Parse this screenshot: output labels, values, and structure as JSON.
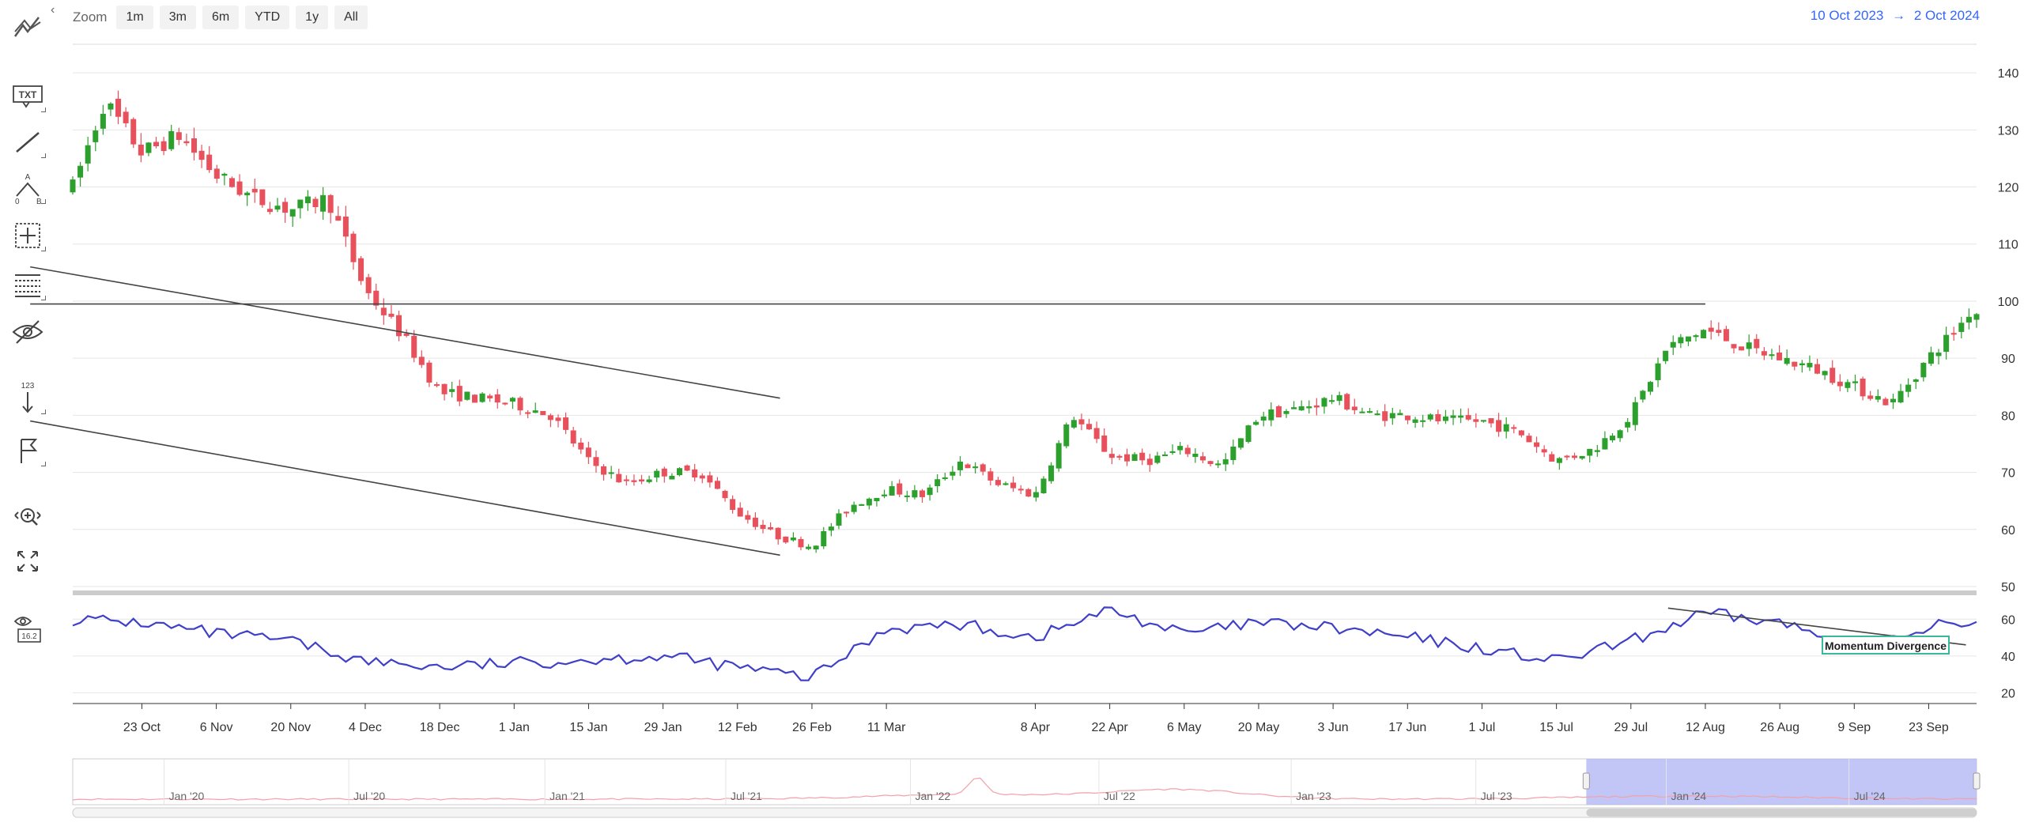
{
  "toolbar": {
    "collapse_glyph": "‹",
    "tools": [
      {
        "name": "indicators-icon",
        "label": ""
      },
      {
        "name": "text-annotation-icon",
        "label": "TXT"
      },
      {
        "name": "line-tool-icon",
        "label": ""
      },
      {
        "name": "elliott-wave-icon",
        "label": "A 0 B"
      },
      {
        "name": "measure-icon",
        "label": ""
      },
      {
        "name": "fibonacci-icon",
        "label": ""
      },
      {
        "name": "hide-annotations-icon",
        "label": ""
      },
      {
        "name": "vertical-counter-icon",
        "label": "123"
      },
      {
        "name": "flag-icon",
        "label": ""
      },
      {
        "name": "zoom-pan-icon",
        "label": ""
      },
      {
        "name": "fullscreen-icon",
        "label": ""
      },
      {
        "name": "current-price-indicator-icon",
        "label": "16.2"
      }
    ]
  },
  "zoom": {
    "label": "Zoom",
    "buttons": [
      "1m",
      "3m",
      "6m",
      "YTD",
      "1y",
      "All"
    ]
  },
  "range": {
    "from": "10 Oct 2023",
    "arrow": "→",
    "to": "2 Oct 2024"
  },
  "chart_data": {
    "type": "candlestick",
    "price_axis": {
      "ticks": [
        50,
        60,
        70,
        80,
        90,
        100,
        110,
        120,
        130,
        140
      ],
      "range": [
        50,
        145
      ]
    },
    "oscillator_axis": {
      "ticks": [
        20,
        40,
        60
      ],
      "range": [
        15,
        70
      ]
    },
    "x_axis_labels": [
      "23 Oct",
      "6 Nov",
      "20 Nov",
      "4 Dec",
      "18 Dec",
      "1 Jan",
      "15 Jan",
      "29 Jan",
      "12 Feb",
      "26 Feb",
      "11 Mar",
      "8 Apr",
      "22 Apr",
      "6 May",
      "20 May",
      "3 Jun",
      "17 Jun",
      "1 Jul",
      "15 Jul",
      "29 Jul",
      "12 Aug",
      "26 Aug",
      "9 Sep",
      "23 Sep"
    ],
    "price_close_path": [
      [
        "10 Oct",
        120
      ],
      [
        "16 Oct",
        135
      ],
      [
        "23 Oct",
        126
      ],
      [
        "30 Oct",
        129
      ],
      [
        "6 Nov",
        122
      ],
      [
        "13 Nov",
        118
      ],
      [
        "20 Nov",
        116
      ],
      [
        "27 Nov",
        118
      ],
      [
        "4 Dec",
        102
      ],
      [
        "11 Dec",
        94
      ],
      [
        "18 Dec",
        84
      ],
      [
        "25 Dec",
        83
      ],
      [
        "1 Jan",
        82
      ],
      [
        "8 Jan",
        80
      ],
      [
        "15 Jan",
        72
      ],
      [
        "22 Jan",
        68
      ],
      [
        "29 Jan",
        70
      ],
      [
        "5 Feb",
        70
      ],
      [
        "12 Feb",
        63
      ],
      [
        "19 Feb",
        59
      ],
      [
        "26 Feb",
        57
      ],
      [
        "4 Mar",
        64
      ],
      [
        "11 Mar",
        67
      ],
      [
        "18 Mar",
        66
      ],
      [
        "25 Mar",
        72
      ],
      [
        "1 Apr",
        68
      ],
      [
        "8 Apr",
        66
      ],
      [
        "15 Apr",
        80
      ],
      [
        "22 Apr",
        73
      ],
      [
        "29 Apr",
        72
      ],
      [
        "6 May",
        74
      ],
      [
        "13 May",
        71
      ],
      [
        "20 May",
        80
      ],
      [
        "27 May",
        81
      ],
      [
        "3 Jun",
        83
      ],
      [
        "10 Jun",
        80
      ],
      [
        "17 Jun",
        80
      ],
      [
        "24 Jun",
        79
      ],
      [
        "1 Jul",
        79
      ],
      [
        "8 Jul",
        77
      ],
      [
        "15 Jul",
        72
      ],
      [
        "22 Jul",
        74
      ],
      [
        "29 Jul",
        80
      ],
      [
        "5 Aug",
        92
      ],
      [
        "12 Aug",
        95
      ],
      [
        "19 Aug",
        92
      ],
      [
        "26 Aug",
        90
      ],
      [
        "2 Sep",
        88
      ],
      [
        "9 Sep",
        85
      ],
      [
        "16 Sep",
        82
      ],
      [
        "23 Sep",
        90
      ],
      [
        "30 Sep",
        97
      ],
      [
        "2 Oct",
        98
      ]
    ],
    "momentum_path": [
      [
        "10 Oct",
        60
      ],
      [
        "23 Oct",
        58
      ],
      [
        "6 Nov",
        52
      ],
      [
        "20 Nov",
        48
      ],
      [
        "4 Dec",
        37
      ],
      [
        "18 Dec",
        34
      ],
      [
        "1 Jan",
        36
      ],
      [
        "15 Jan",
        38
      ],
      [
        "29 Jan",
        40
      ],
      [
        "12 Feb",
        34
      ],
      [
        "26 Feb",
        28
      ],
      [
        "11 Mar",
        55
      ],
      [
        "25 Mar",
        57
      ],
      [
        "8 Apr",
        50
      ],
      [
        "22 Apr",
        65
      ],
      [
        "6 May",
        52
      ],
      [
        "20 May",
        58
      ],
      [
        "3 Jun",
        55
      ],
      [
        "17 Jun",
        50
      ],
      [
        "1 Jul",
        44
      ],
      [
        "15 Jul",
        37
      ],
      [
        "29 Jul",
        48
      ],
      [
        "12 Aug",
        63
      ],
      [
        "26 Aug",
        58
      ],
      [
        "9 Sep",
        46
      ],
      [
        "23 Sep",
        50
      ],
      [
        "2 Oct",
        58
      ]
    ],
    "trendlines": [
      {
        "name": "upper-channel",
        "from": [
          "20 Feb",
          83
        ],
        "to": [
          "2 Oct",
          106
        ]
      },
      {
        "name": "lower-channel",
        "from": [
          "20 Feb",
          55.5
        ],
        "to": [
          "2 Oct",
          79
        ]
      },
      {
        "name": "resistance",
        "from": [
          "12 Aug",
          99.5
        ],
        "to": [
          "2 Oct",
          99.5
        ]
      }
    ],
    "annotation": {
      "label": "Momentum Divergence"
    },
    "navigator_labels": [
      "Jan '20",
      "Jul '20",
      "Jan '21",
      "Jul '21",
      "Jan '22",
      "Jul '22",
      "Jan '23",
      "Jul '23",
      "Jan '24",
      "Jul '24"
    ],
    "colors": {
      "up": "#2ca02c",
      "down": "#e8505b",
      "oscillator": "#3f3fc8",
      "grid": "#e6e6e6",
      "navigator_fill": "#b3b8f5",
      "navigator_line": "#f4a0a8",
      "range_text": "#3366ff"
    }
  }
}
